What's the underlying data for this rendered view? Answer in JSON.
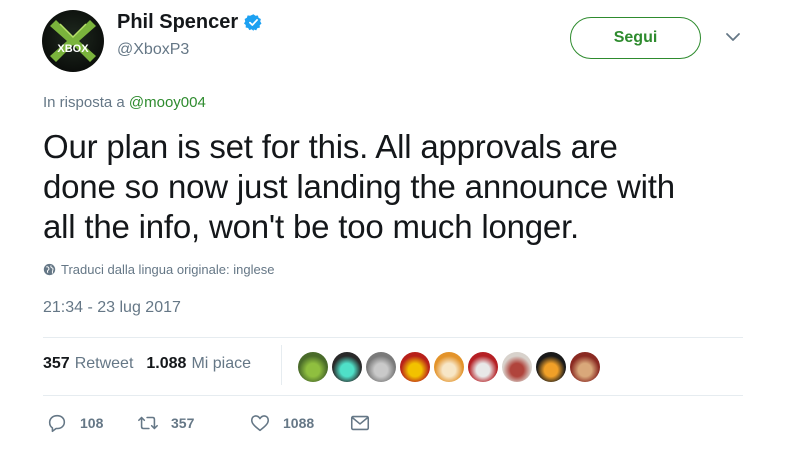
{
  "author": {
    "display_name": "Phil Spencer",
    "handle": "@XboxP3",
    "avatar_text": "XBOX",
    "verified": true
  },
  "follow_button": {
    "label": "Segui"
  },
  "reply_context": {
    "prefix": "In risposta a ",
    "target": "@mooy004"
  },
  "tweet": {
    "lines": [
      "Our plan is set for this.  All approvals are",
      "done so now just landing the announce with",
      "all the info, won't be too much longer."
    ]
  },
  "translate": {
    "label": "Traduci dalla lingua originale: inglese",
    "icon": "globe-icon"
  },
  "timestamp": "21:34 - 23 lug 2017",
  "stats": {
    "retweets_count": "357",
    "retweets_label": "Retweet",
    "likes_count": "1.088",
    "likes_label": "Mi piace"
  },
  "likers": [
    {
      "color": "#4a6b2a",
      "accent": "#8fbf3f"
    },
    {
      "color": "#2a2a2a",
      "accent": "#4fe0c8"
    },
    {
      "color": "#7a7a7a",
      "accent": "#c9c9c9"
    },
    {
      "color": "#b8211a",
      "accent": "#f2c200"
    },
    {
      "color": "#e3932a",
      "accent": "#f7e6c6"
    },
    {
      "color": "#b51f24",
      "accent": "#e8e8e8"
    },
    {
      "color": "#d8d2cc",
      "accent": "#b0443c"
    },
    {
      "color": "#1a1a1a",
      "accent": "#f0a028"
    },
    {
      "color": "#8a2a22",
      "accent": "#d9a87a"
    }
  ],
  "actions": {
    "reply_count": "108",
    "retweet_count": "357",
    "like_count": "1088"
  },
  "colors": {
    "accent_green": "#2e8b2e",
    "text_primary": "#14171a",
    "text_secondary": "#657786",
    "verified_blue": "#1da1f2",
    "divider": "#e6ecf0"
  }
}
